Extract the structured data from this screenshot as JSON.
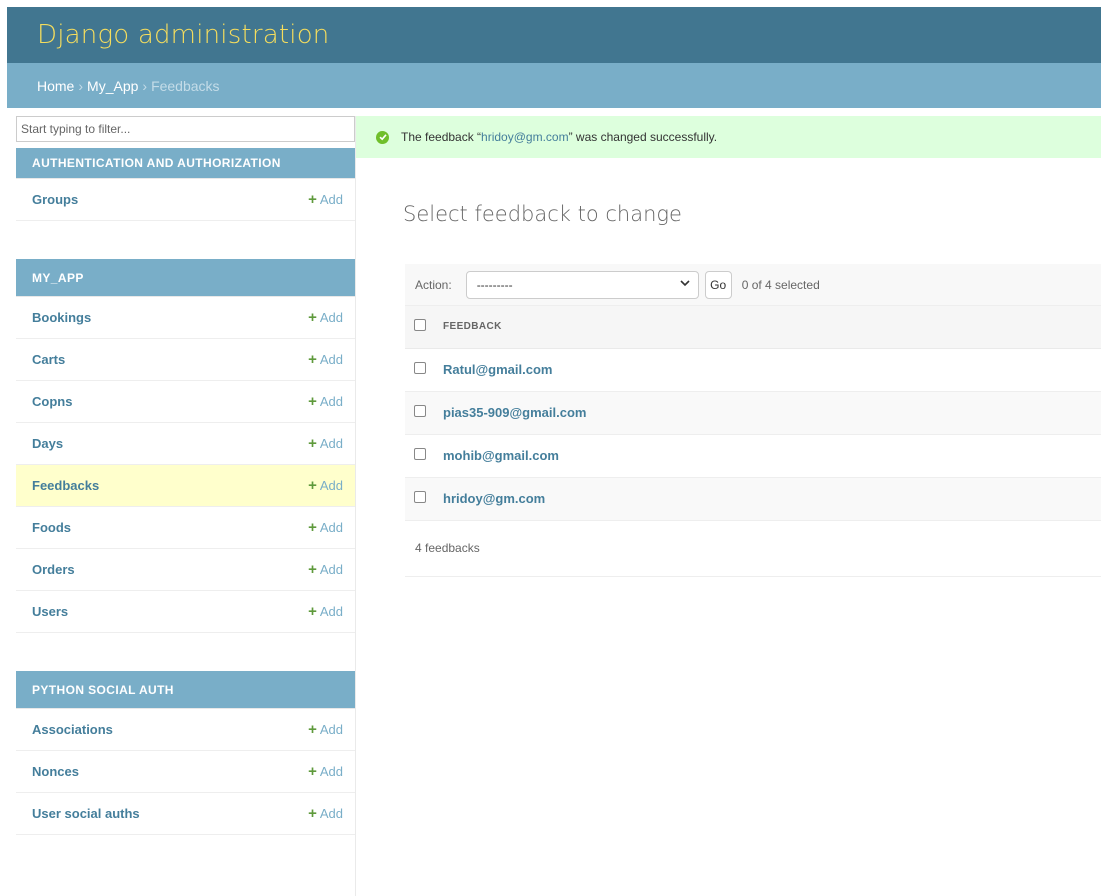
{
  "header": {
    "site_name": "Django administration"
  },
  "breadcrumbs": {
    "home": "Home",
    "app": "My_App",
    "current": "Feedbacks",
    "separator": "›"
  },
  "sidebar": {
    "filter_placeholder": "Start typing to filter...",
    "add_label": "Add",
    "apps": [
      {
        "caption": "Authentication and Authorization",
        "models": [
          "Groups"
        ]
      },
      {
        "caption": "My_App",
        "models": [
          "Bookings",
          "Carts",
          "Copns",
          "Days",
          "Feedbacks",
          "Foods",
          "Orders",
          "Users"
        ],
        "current": "Feedbacks"
      },
      {
        "caption": "Python Social Auth",
        "models": [
          "Associations",
          "Nonces",
          "User social auths"
        ]
      }
    ]
  },
  "message": {
    "prefix": "The feedback “",
    "object": "hridoy@gm.com",
    "suffix": "” was changed successfully."
  },
  "page_title": "Select feedback to change",
  "actions": {
    "label": "Action:",
    "selected_option": "---------",
    "go_label": "Go",
    "selected_count": "0 of 4 selected"
  },
  "table": {
    "column_header": "Feedback",
    "rows": [
      "Ratul@gmail.com",
      "pias35-909@gmail.com",
      "mohib@gmail.com",
      "hridoy@gm.com"
    ]
  },
  "paginator": {
    "count_text": "4 feedbacks"
  },
  "colors": {
    "header_bg": "#417690",
    "site_name": "#f5dd5d",
    "breadcrumbs_bg": "#79aec8",
    "link": "#447e9b",
    "success_bg": "#ddffdd",
    "current_row": "#ffffcc",
    "add_icon": "#5f9a3c"
  }
}
